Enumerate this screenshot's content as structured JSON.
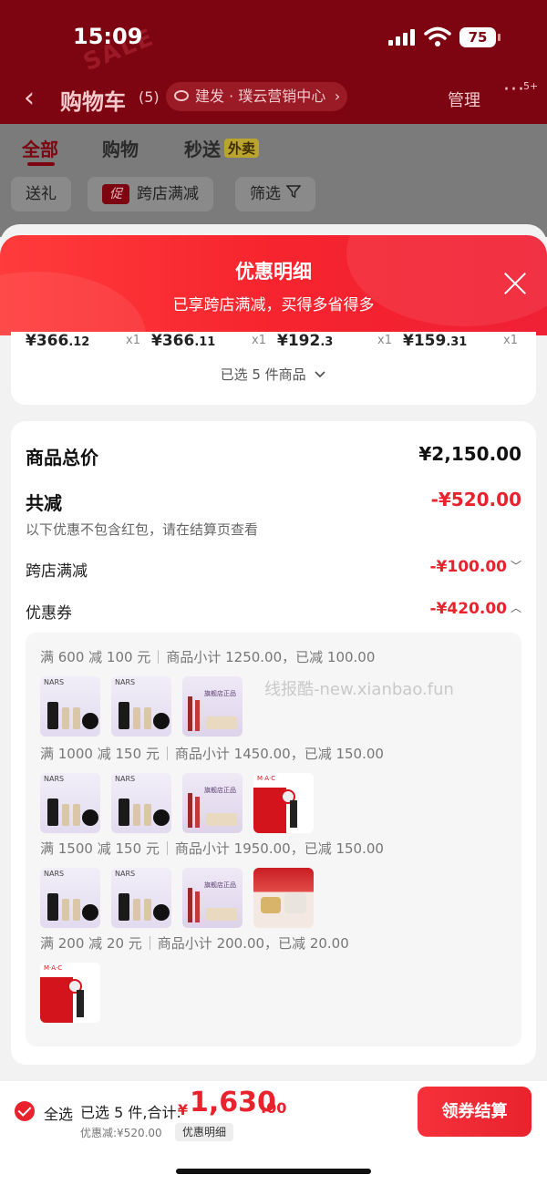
{
  "status_bar": {
    "time": "15:09",
    "battery": "75"
  },
  "nav": {
    "back": "‹",
    "title": "购物车",
    "count": "(5)",
    "address": "建发 · 璞云营销中心",
    "manage": "管理",
    "more": "···",
    "more_badge": "5+"
  },
  "tabs": {
    "all": "全部",
    "shop": "购物",
    "flash": "秒送",
    "takeout": "外卖"
  },
  "chips": {
    "gift": "送礼",
    "promo_badge": "促",
    "cross_store": "跨店满减",
    "filter": "筛选"
  },
  "sheet": {
    "title": "优惠明细",
    "subtitle": "已享跨店满减，买得多省得多",
    "products": [
      {
        "price_int": "¥366",
        "price_dec": ".12",
        "qty": "x1"
      },
      {
        "price_int": "¥366",
        "price_dec": ".11",
        "qty": "x1"
      },
      {
        "price_int": "¥192",
        "price_dec": ".3",
        "qty": "x1"
      },
      {
        "price_int": "¥159",
        "price_dec": ".31",
        "qty": "x1"
      }
    ],
    "selected_text": "已选 5 件商品",
    "total_label": "商品总价",
    "total_value": "¥2,150.00",
    "discount_label": "共减",
    "discount_value": "-¥520.00",
    "discount_note": "以下优惠不包含红包，请在结算页查看",
    "cross_label": "跨店满减",
    "cross_value": "-¥100.00",
    "coupon_label": "优惠券",
    "coupon_value": "-¥420.00",
    "coupon_groups": [
      {
        "rule": "满 600 减 100 元",
        "detail": "商品小计 1250.00，已减 100.00",
        "items": [
          "nars",
          "nars",
          "nars2"
        ]
      },
      {
        "rule": "满 1000 减 150 元",
        "detail": "商品小计 1450.00，已减 150.00",
        "items": [
          "nars",
          "nars",
          "nars2",
          "mac"
        ]
      },
      {
        "rule": "满 1500 减 150 元",
        "detail": "商品小计 1950.00，已减 150.00",
        "items": [
          "nars",
          "nars",
          "nars2",
          "est"
        ]
      },
      {
        "rule": "满 200 减 20 元",
        "detail": "商品小计 200.00，已减 20.00",
        "items": [
          "mac"
        ]
      }
    ],
    "watermark": "线报酷-new.xianbao.fun"
  },
  "bottom": {
    "select_all": "全选",
    "selected": "已选 5 件,合计:",
    "currency": "¥",
    "total_int": "1,630",
    "total_dec": ".00",
    "discount": "优惠减:¥520.00",
    "detail": "优惠明细",
    "checkout": "领券结算"
  },
  "colors": {
    "accent": "#e8232e",
    "header_dim": "#7d0512"
  }
}
